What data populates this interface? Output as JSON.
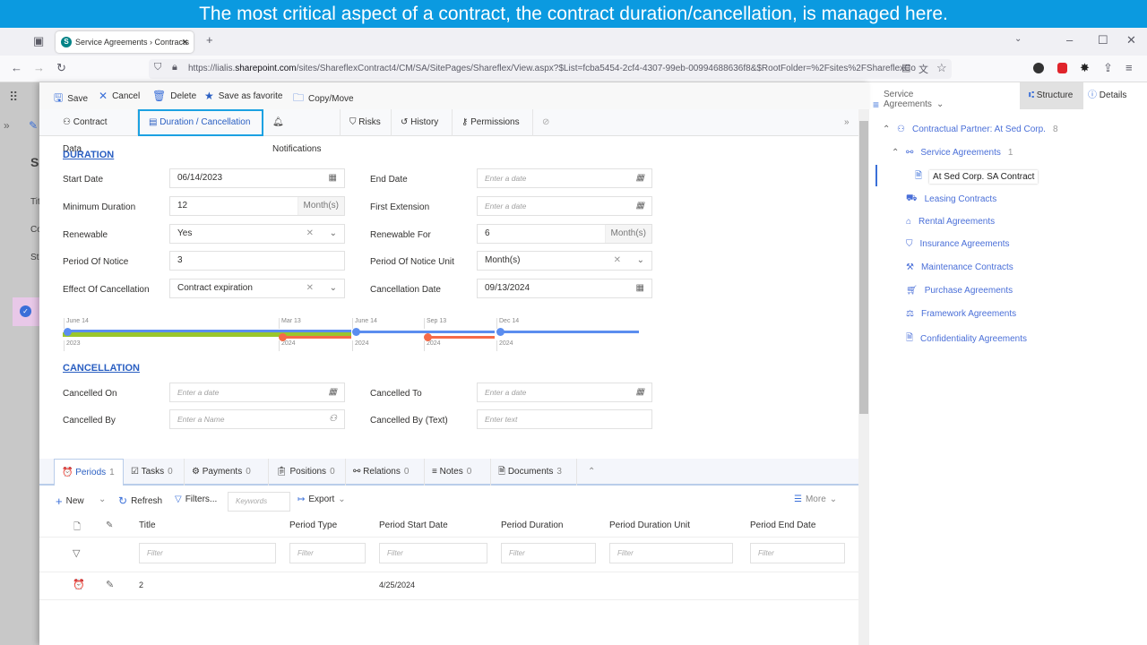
{
  "banner": "The most critical aspect of a contract, the contract duration/cancellation, is managed here.",
  "browser": {
    "tab_title": "Service Agreements › Contracts",
    "url_prefix": "https://lialis.",
    "url_domain": "sharepoint.com",
    "url_rest": "/sites/ShareflexContract4/CM/SA/SitePages/Shareflex/View.aspx?$List=fcba5454-2cf4-4307-99eb-00994688636f8&$RootFolder=%2Fsites%2FShareflexCo"
  },
  "background_page": {
    "title": "Se",
    "labels": [
      "Tit",
      "Co",
      "St"
    ]
  },
  "toolbar": {
    "save": "Save",
    "cancel": "Cancel",
    "delete": "Delete",
    "favorite": "Save as favorite",
    "copy_move": "Copy/Move"
  },
  "right_header": {
    "view": "Service Agreements · Contracts",
    "structure": "Structure",
    "details": "Details"
  },
  "tabs": [
    "Contract Data",
    "Duration / Cancellation",
    "Notifications",
    "Risks",
    "History",
    "Permissions"
  ],
  "duration": {
    "heading": "DURATION",
    "start_date": {
      "label": "Start Date",
      "value": "06/14/2023"
    },
    "end_date": {
      "label": "End Date",
      "placeholder": "Enter a date"
    },
    "min_duration": {
      "label": "Minimum Duration",
      "value": "12",
      "unit": "Month(s)"
    },
    "first_extension": {
      "label": "First Extension",
      "placeholder": "Enter a date"
    },
    "renewable": {
      "label": "Renewable",
      "value": "Yes"
    },
    "renewable_for": {
      "label": "Renewable For",
      "value": "6",
      "unit": "Month(s)"
    },
    "notice": {
      "label": "Period Of Notice",
      "value": "3"
    },
    "notice_unit": {
      "label": "Period Of Notice Unit",
      "value": "Month(s)"
    },
    "effect": {
      "label": "Effect Of Cancellation",
      "value": "Contract expiration"
    },
    "cancellation_date": {
      "label": "Cancellation Date",
      "value": "09/13/2024"
    }
  },
  "timeline": {
    "colors": {
      "duration": "#5b8def",
      "minimum": "#9ac62c",
      "notice": "#f56a48"
    },
    "ticks": [
      {
        "date": "June 14",
        "year": "2023"
      },
      {
        "date": "Mar 13",
        "year": "2024"
      },
      {
        "date": "June 14",
        "year": "2024"
      },
      {
        "date": "Sep 13",
        "year": "2024"
      },
      {
        "date": "Dec 14",
        "year": "2024"
      }
    ]
  },
  "cancellation": {
    "heading": "CANCELLATION",
    "cancelled_on": {
      "label": "Cancelled On",
      "placeholder": "Enter a date"
    },
    "cancelled_to": {
      "label": "Cancelled To",
      "placeholder": "Enter a date"
    },
    "cancelled_by": {
      "label": "Cancelled By",
      "placeholder": "Enter a Name"
    },
    "cancelled_by_text": {
      "label": "Cancelled By (Text)",
      "placeholder": "Enter text"
    }
  },
  "bottom_tabs": [
    {
      "label": "Periods",
      "count": "1"
    },
    {
      "label": "Tasks",
      "count": "0"
    },
    {
      "label": "Payments",
      "count": "0"
    },
    {
      "label": "Positions",
      "count": "0"
    },
    {
      "label": "Relations",
      "count": "0"
    },
    {
      "label": "Notes",
      "count": "0"
    },
    {
      "label": "Documents",
      "count": "3"
    }
  ],
  "grid": {
    "new": "New",
    "refresh": "Refresh",
    "filters": "Filters...",
    "keywords_placeholder": "Keywords",
    "export": "Export",
    "more": "More",
    "columns": [
      "Title",
      "Period Type",
      "Period Start Date",
      "Period Duration",
      "Period Duration Unit",
      "Period End Date"
    ],
    "filter_placeholder": "Filter",
    "rows": [
      {
        "title": "2",
        "type": "",
        "start": "4/25/2024",
        "duration": "",
        "unit": "",
        "end": ""
      }
    ]
  },
  "structure": {
    "partner": {
      "label": "Contractual Partner: At Sed Corp.",
      "count": "8"
    },
    "service": {
      "label": "Service Agreements",
      "count": "1"
    },
    "selected": "At Sed Corp. SA Contract",
    "others": [
      "Leasing Contracts",
      "Rental Agreements",
      "Insurance Agreements",
      "Maintenance Contracts",
      "Purchase Agreements",
      "Framework Agreements",
      "Confidentiality Agreements"
    ]
  }
}
